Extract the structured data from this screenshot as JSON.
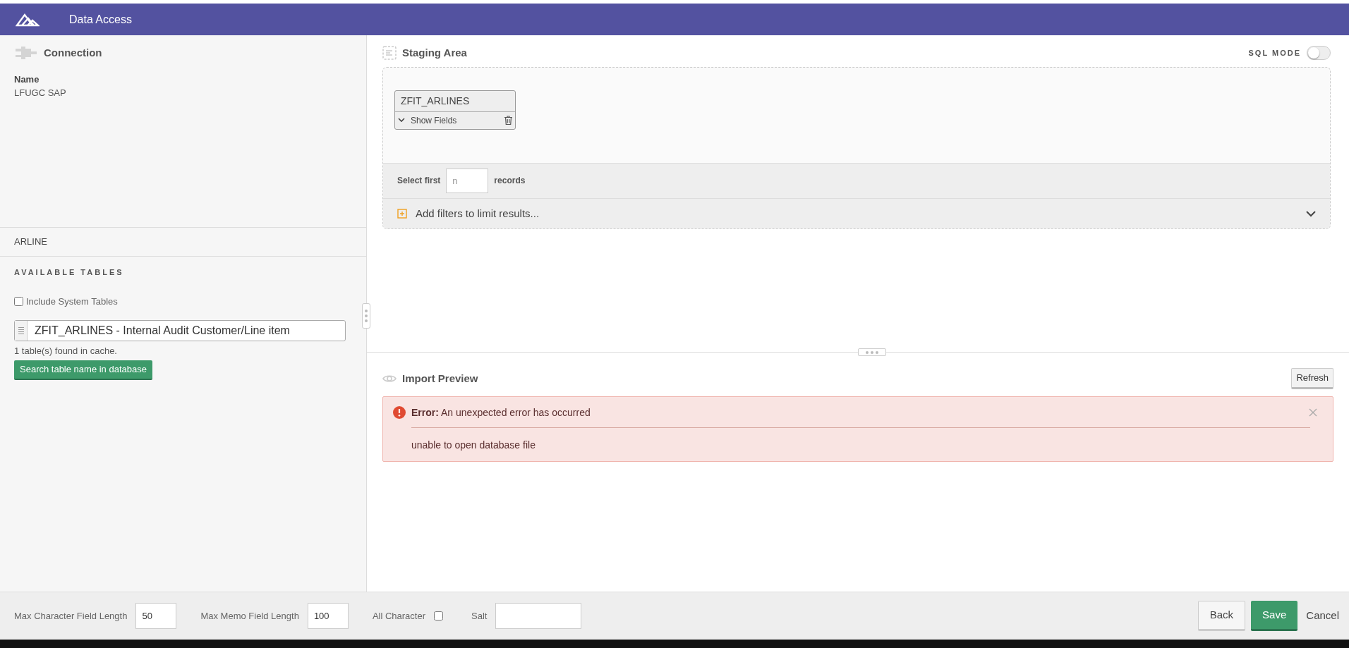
{
  "header": {
    "title": "Data Access"
  },
  "connection": {
    "title": "Connection",
    "name_label": "Name",
    "name_value": "LFUGC SAP"
  },
  "search_term": "ARLINE",
  "available_tables": {
    "title": "AVAILABLE TABLES",
    "include_system": {
      "label": "Include System Tables",
      "checked": false
    },
    "selected_table": "ZFIT_ARLINES - Internal Audit Customer/Line item",
    "found_text": "1 table(s) found in cache.",
    "search_button": "Search table name in database"
  },
  "staging": {
    "title": "Staging Area",
    "sql_mode": {
      "label": "SQL MODE",
      "on": false
    },
    "tables": [
      {
        "name": "ZFIT_ARLINES",
        "toggle": "Show Fields",
        "expanded": false
      }
    ],
    "select_first": {
      "label": "Select first",
      "placeholder": "n",
      "suffix": "records"
    },
    "filters": {
      "label": "Add filters to limit results...",
      "expanded": false
    }
  },
  "import_preview": {
    "title": "Import Preview",
    "refresh": "Refresh",
    "error": {
      "message": "**Error:** An unexpected error has occurred",
      "detail": "unable to open database file"
    }
  },
  "footer": {
    "fields": [
      {
        "kind": "text",
        "label": "Max Character Field Length",
        "value": "50"
      },
      {
        "kind": "text",
        "label": "Max Memo Field Length",
        "value": "100"
      },
      {
        "kind": "checkbox",
        "label": "All Character",
        "checked": false
      },
      {
        "kind": "text",
        "label": "Salt"
      }
    ],
    "buttons": {
      "back": "Back",
      "save": "Save",
      "cancel": "Cancel"
    }
  }
}
